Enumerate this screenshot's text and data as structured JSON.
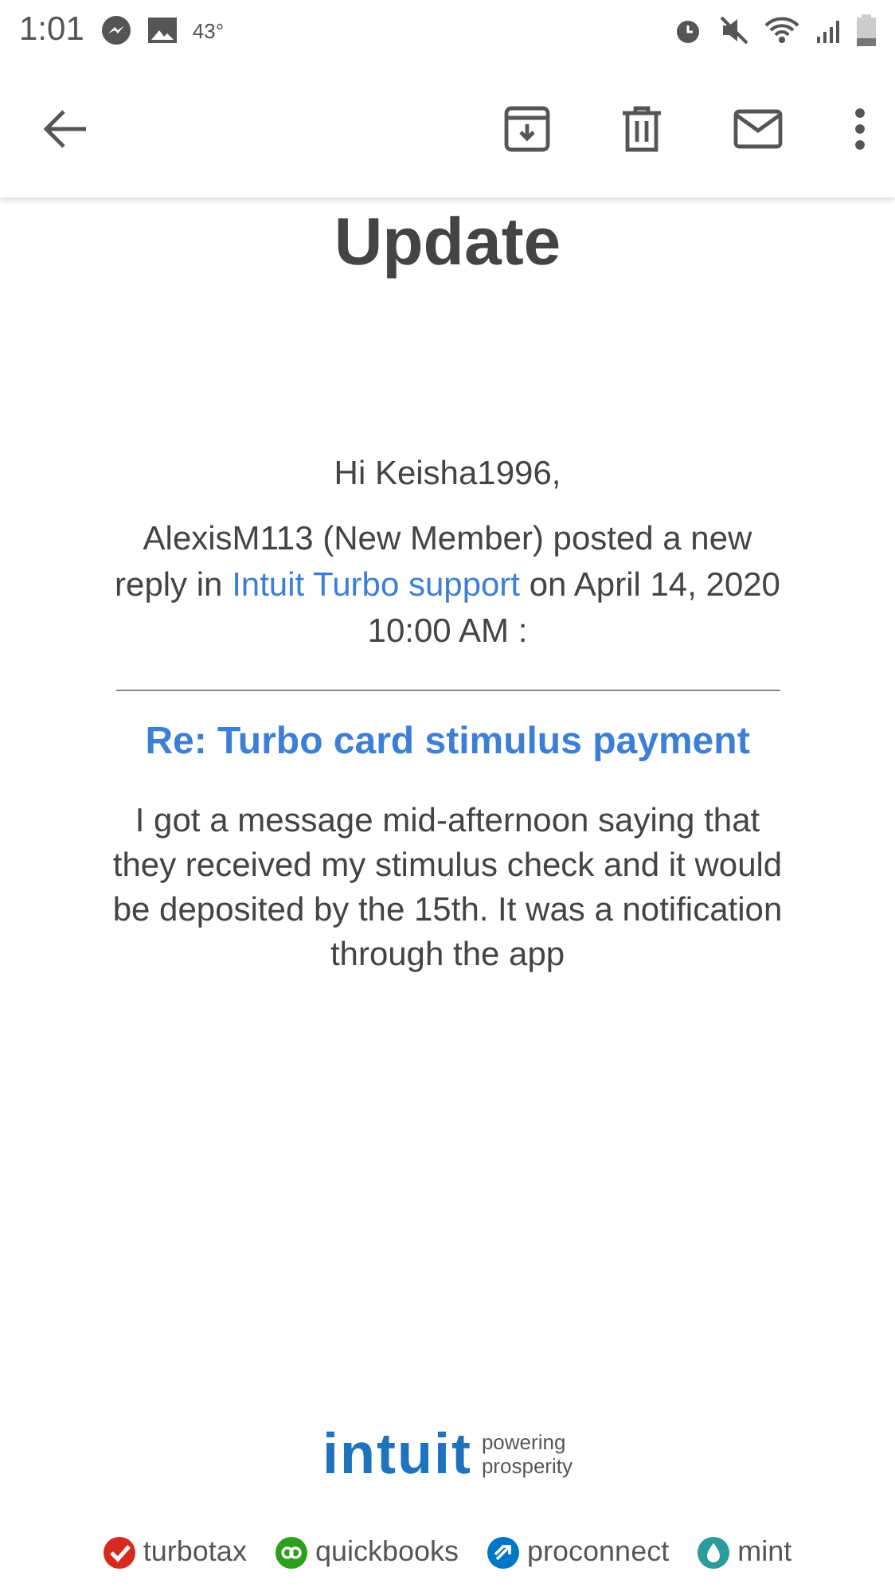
{
  "status_bar": {
    "time": "1:01",
    "temperature": "43°"
  },
  "email": {
    "heading": "Update",
    "greeting": "Hi Keisha1996,",
    "notice": {
      "before": "AlexisM113 (New Member) posted a new reply in",
      "link": "Intuit Turbo support",
      "after": "on April 14, 2020 10:00 AM :"
    },
    "post_title": "Re: Turbo card stimulus payment",
    "post_body": "I got a message mid-afternoon saying that they received my stimulus check and it would be deposited by the 15th. It was a notification through the app"
  },
  "footer": {
    "logo": "intuit",
    "tagline": [
      "powering",
      "prosperity"
    ],
    "brands": [
      {
        "name": "turbotax",
        "color": "#d52b1e",
        "kind": "check"
      },
      {
        "name": "quickbooks",
        "color": "#2ca01c",
        "kind": "rings"
      },
      {
        "name": "proconnect",
        "color": "#0077c5",
        "kind": "arrow"
      },
      {
        "name": "mint",
        "color": "#2b9c9c",
        "kind": "drop"
      }
    ]
  }
}
